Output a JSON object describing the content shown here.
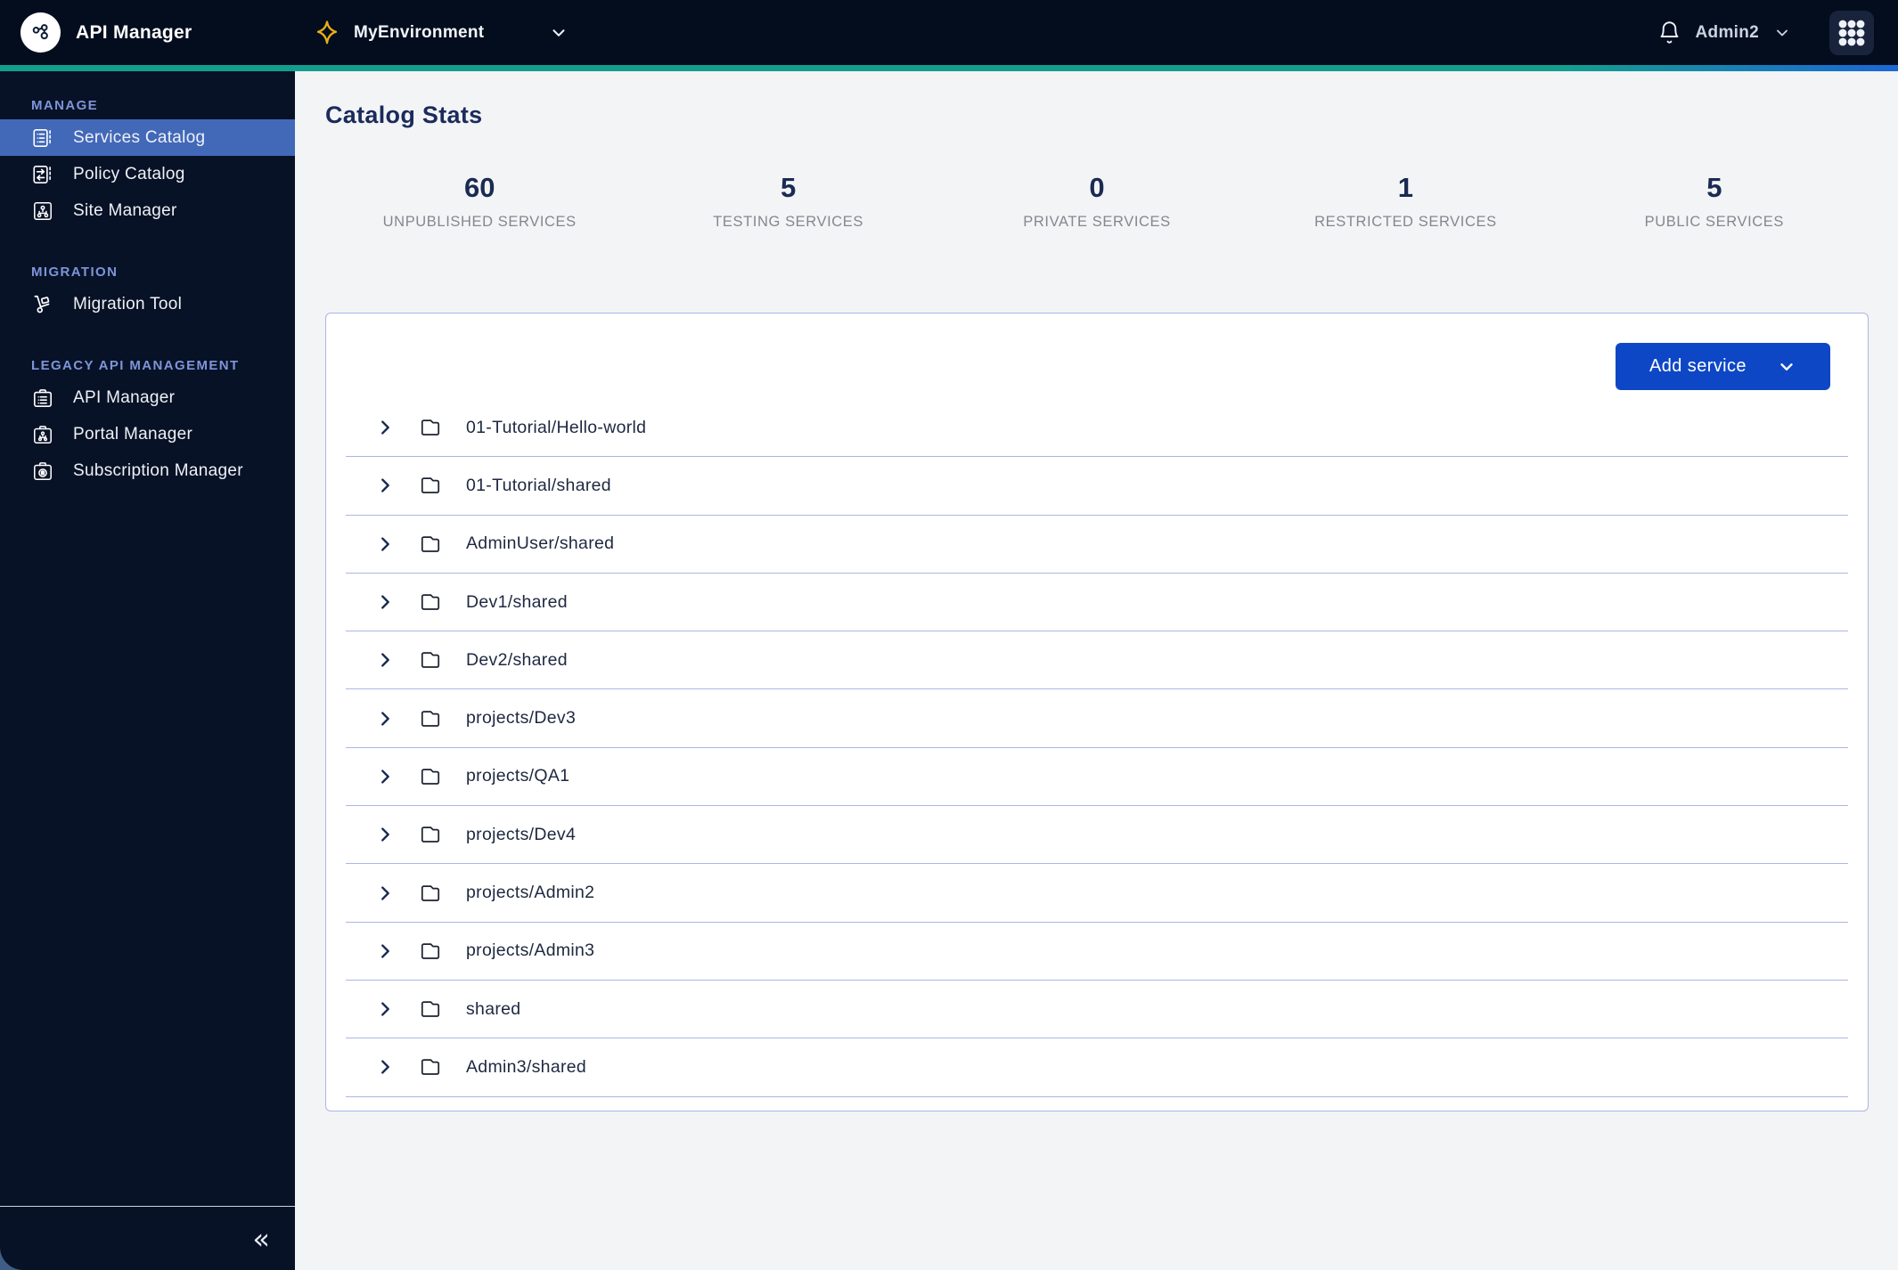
{
  "colors": {
    "header_bg": "#040d1e",
    "sidebar_bg": "#081226",
    "accent_teal": "#149e8d",
    "accent_blue": "#1b6ad1",
    "selected_nav_bg": "#4268b8",
    "primary_button_bg": "#0e47c6",
    "star_gold": "#e9ae17"
  },
  "header": {
    "app_title": "API Manager",
    "environment": "MyEnvironment",
    "user": "Admin2"
  },
  "sidebar": {
    "sections": [
      {
        "label": "MANAGE",
        "items": [
          {
            "label": "Services Catalog",
            "selected": true
          },
          {
            "label": "Policy Catalog",
            "selected": false
          },
          {
            "label": "Site Manager",
            "selected": false
          }
        ]
      },
      {
        "label": "MIGRATION",
        "items": [
          {
            "label": "Migration Tool",
            "selected": false
          }
        ]
      },
      {
        "label": "LEGACY API MANAGEMENT",
        "items": [
          {
            "label": "API Manager",
            "selected": false
          },
          {
            "label": "Portal Manager",
            "selected": false
          },
          {
            "label": "Subscription Manager",
            "selected": false
          }
        ]
      }
    ],
    "collapse_glyph": "«"
  },
  "main": {
    "title": "Catalog Stats",
    "stats": [
      {
        "value": "60",
        "label": "UNPUBLISHED SERVICES"
      },
      {
        "value": "5",
        "label": "TESTING SERVICES"
      },
      {
        "value": "0",
        "label": "PRIVATE SERVICES"
      },
      {
        "value": "1",
        "label": "RESTRICTED SERVICES"
      },
      {
        "value": "5",
        "label": "PUBLIC SERVICES"
      }
    ],
    "add_service_label": "Add service",
    "folders": [
      "01-Tutorial/Hello-world",
      "01-Tutorial/shared",
      "AdminUser/shared",
      "Dev1/shared",
      "Dev2/shared",
      "projects/Dev3",
      "projects/QA1",
      "projects/Dev4",
      "projects/Admin2",
      "projects/Admin3",
      "shared",
      "Admin3/shared"
    ]
  }
}
